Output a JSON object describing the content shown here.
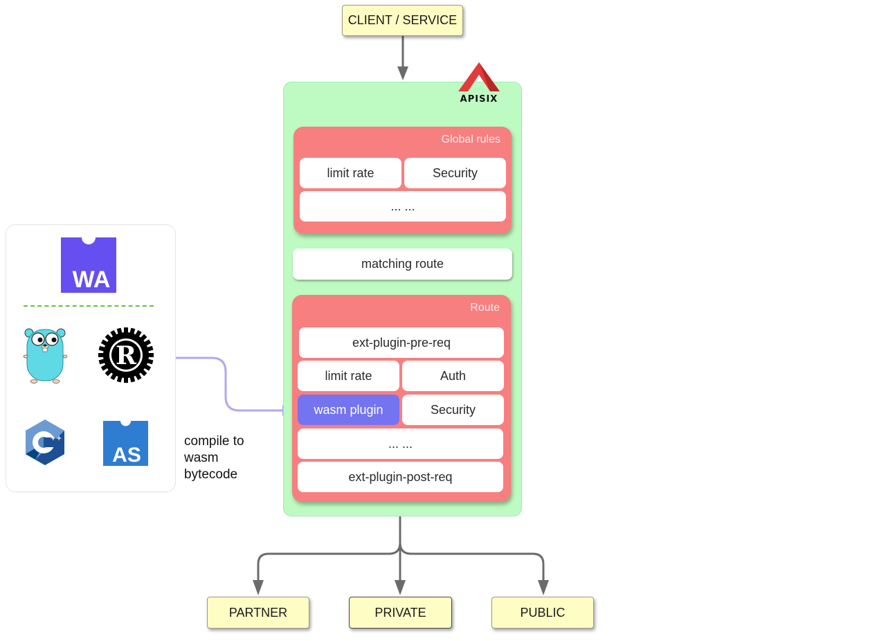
{
  "diagram": {
    "client": {
      "label": "CLIENT / SERVICE"
    },
    "gateway": {
      "logo": {
        "icon": "apisix-logo-icon",
        "text": "APISIX",
        "color": "#e23b3b"
      },
      "global_rules": {
        "title": "Global rules",
        "plugins": [
          "limit rate",
          "Security",
          "... ..."
        ]
      },
      "matching_route": {
        "label": "matching route"
      },
      "route": {
        "title": "Route",
        "plugins": [
          "ext-plugin-pre-req",
          "limit rate",
          "Auth",
          "wasm plugin",
          "Security",
          "... ...",
          "ext-plugin-post-req"
        ],
        "highlighted_plugin": "wasm plugin"
      }
    },
    "languages": {
      "target": {
        "icon": "webassembly-logo-icon",
        "text": "WA"
      },
      "sources": [
        {
          "icon": "go-gopher-icon",
          "name": "Go"
        },
        {
          "icon": "rust-logo-icon",
          "name": "Rust",
          "glyph": "R"
        },
        {
          "icon": "cpp-logo-icon",
          "name": "C++",
          "glyph": "C",
          "sup": "++"
        },
        {
          "icon": "assemblyscript-logo-icon",
          "name": "AssemblyScript",
          "glyph": "AS"
        }
      ]
    },
    "compile_caption": [
      "compile to",
      "wasm",
      "bytecode"
    ],
    "upstreams": [
      {
        "label": "PARTNER"
      },
      {
        "label": "PRIVATE"
      },
      {
        "label": "PUBLIC"
      }
    ],
    "colors": {
      "gateway_bg": "#bdfbc2",
      "rule_group": "#f77f7f",
      "wasm_plugin": "#7474f0",
      "node_fill": "#fdfdc4",
      "arrow": "#6b6b6b",
      "wasm_arrow": "#b0a8f0",
      "dashed_separator": "#5fc23b"
    }
  }
}
